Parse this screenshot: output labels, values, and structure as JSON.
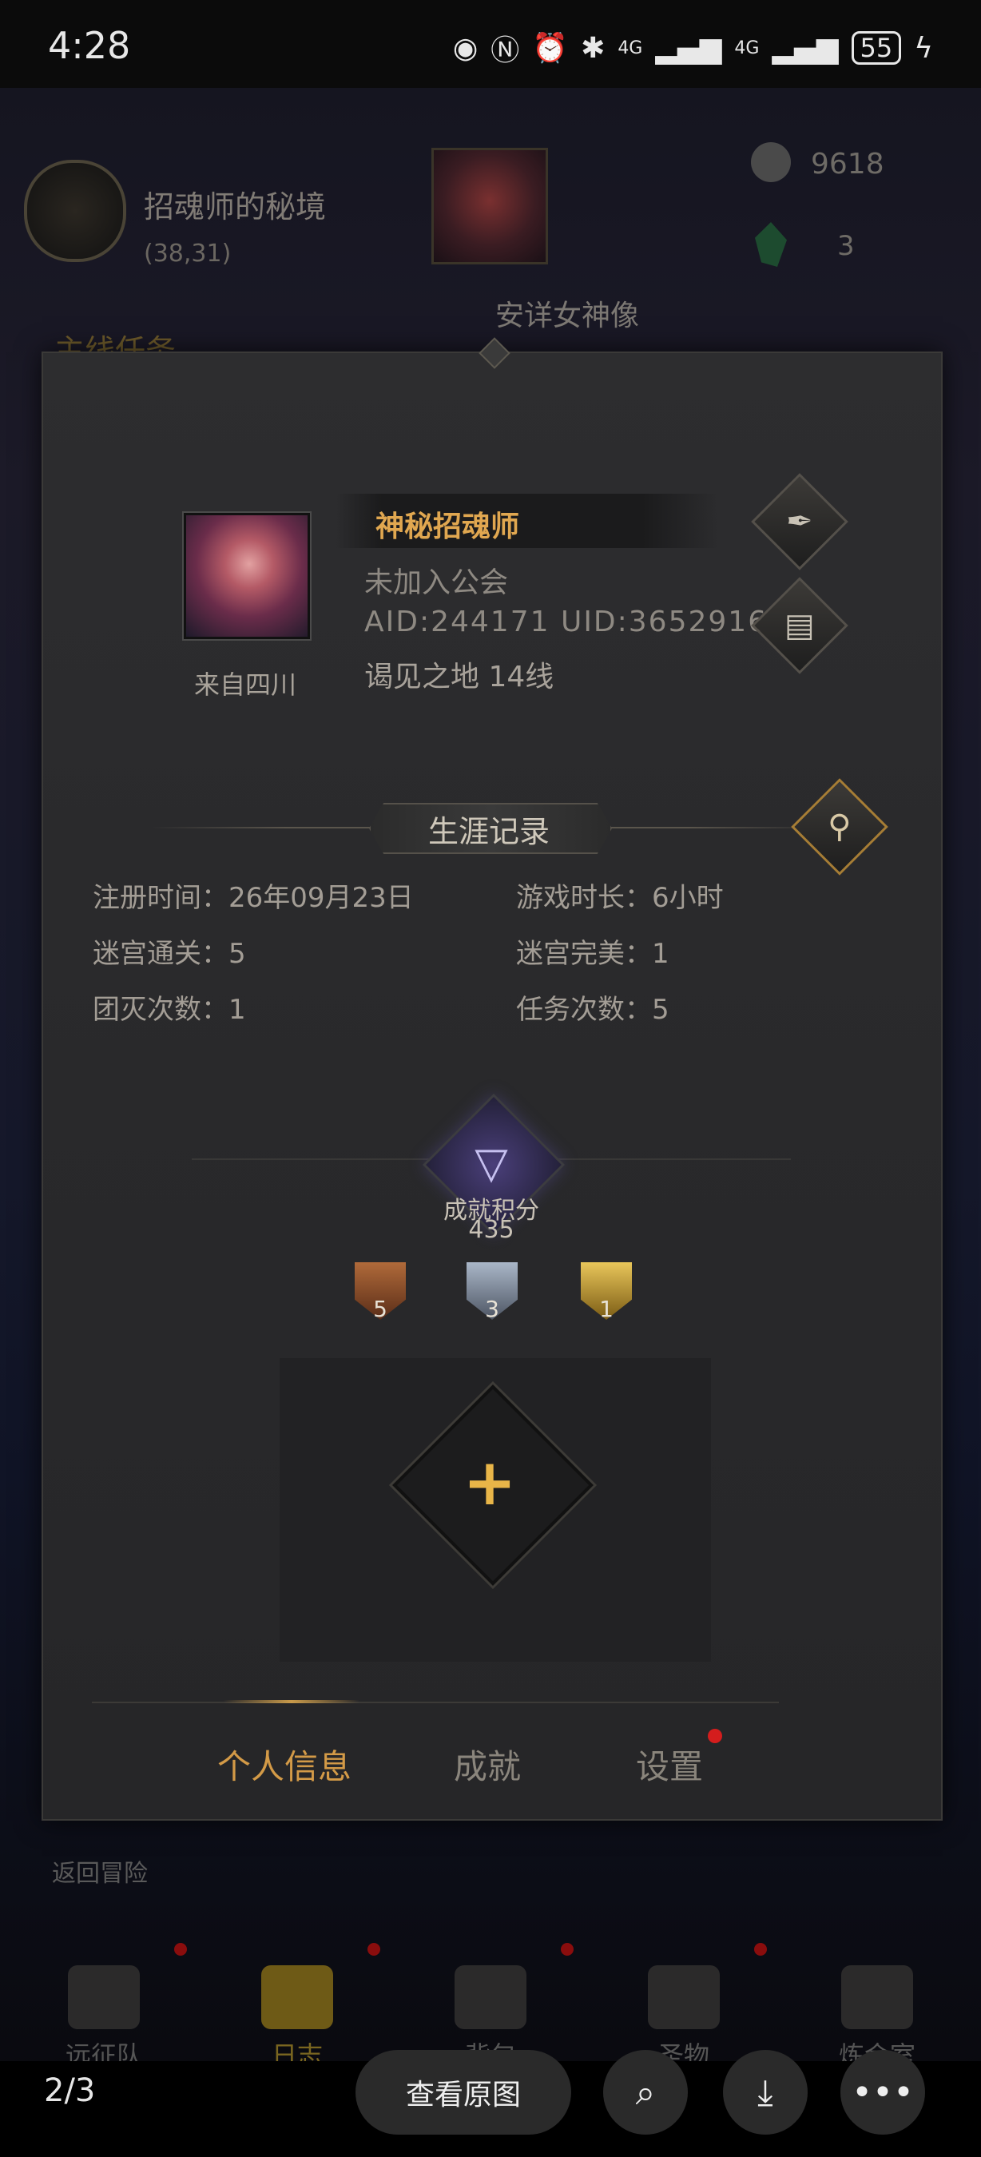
{
  "status_bar": {
    "time": "4:28",
    "battery": "55",
    "signal_labels": [
      "4G",
      "4G"
    ]
  },
  "game_bg": {
    "zone_name": "招魂师的秘境",
    "zone_coords": "(38,31)",
    "statue_name": "安详女神像",
    "resource_1": "9618",
    "resource_2": "3",
    "main_quest": "主线任务",
    "return_label": "返回冒险",
    "nav": [
      "远征队",
      "日志",
      "背包",
      "圣物",
      "炼金室"
    ]
  },
  "profile": {
    "name": "神秘招魂师",
    "guild": "未加入公会",
    "ids": "AID:244171 UID:3652916",
    "server": "谒见之地  14线",
    "from": "来自四川"
  },
  "career": {
    "title": "生涯记录",
    "stats": {
      "register": "注册时间：26年09月23日",
      "playtime": "游戏时长：6小时",
      "maze_clear": "迷宫通关：5",
      "maze_perfect": "迷宫完美：1",
      "wipes": "团灭次数：1",
      "quests": "任务次数：5"
    }
  },
  "achievement": {
    "label": "成就积分",
    "points": "435",
    "badges": {
      "bronze": "5",
      "silver": "3",
      "gold": "1"
    }
  },
  "tabs": {
    "profile": "个人信息",
    "achievements": "成就",
    "settings": "设置"
  },
  "viewer": {
    "counter": "2/3",
    "view_original": "查看原图"
  }
}
